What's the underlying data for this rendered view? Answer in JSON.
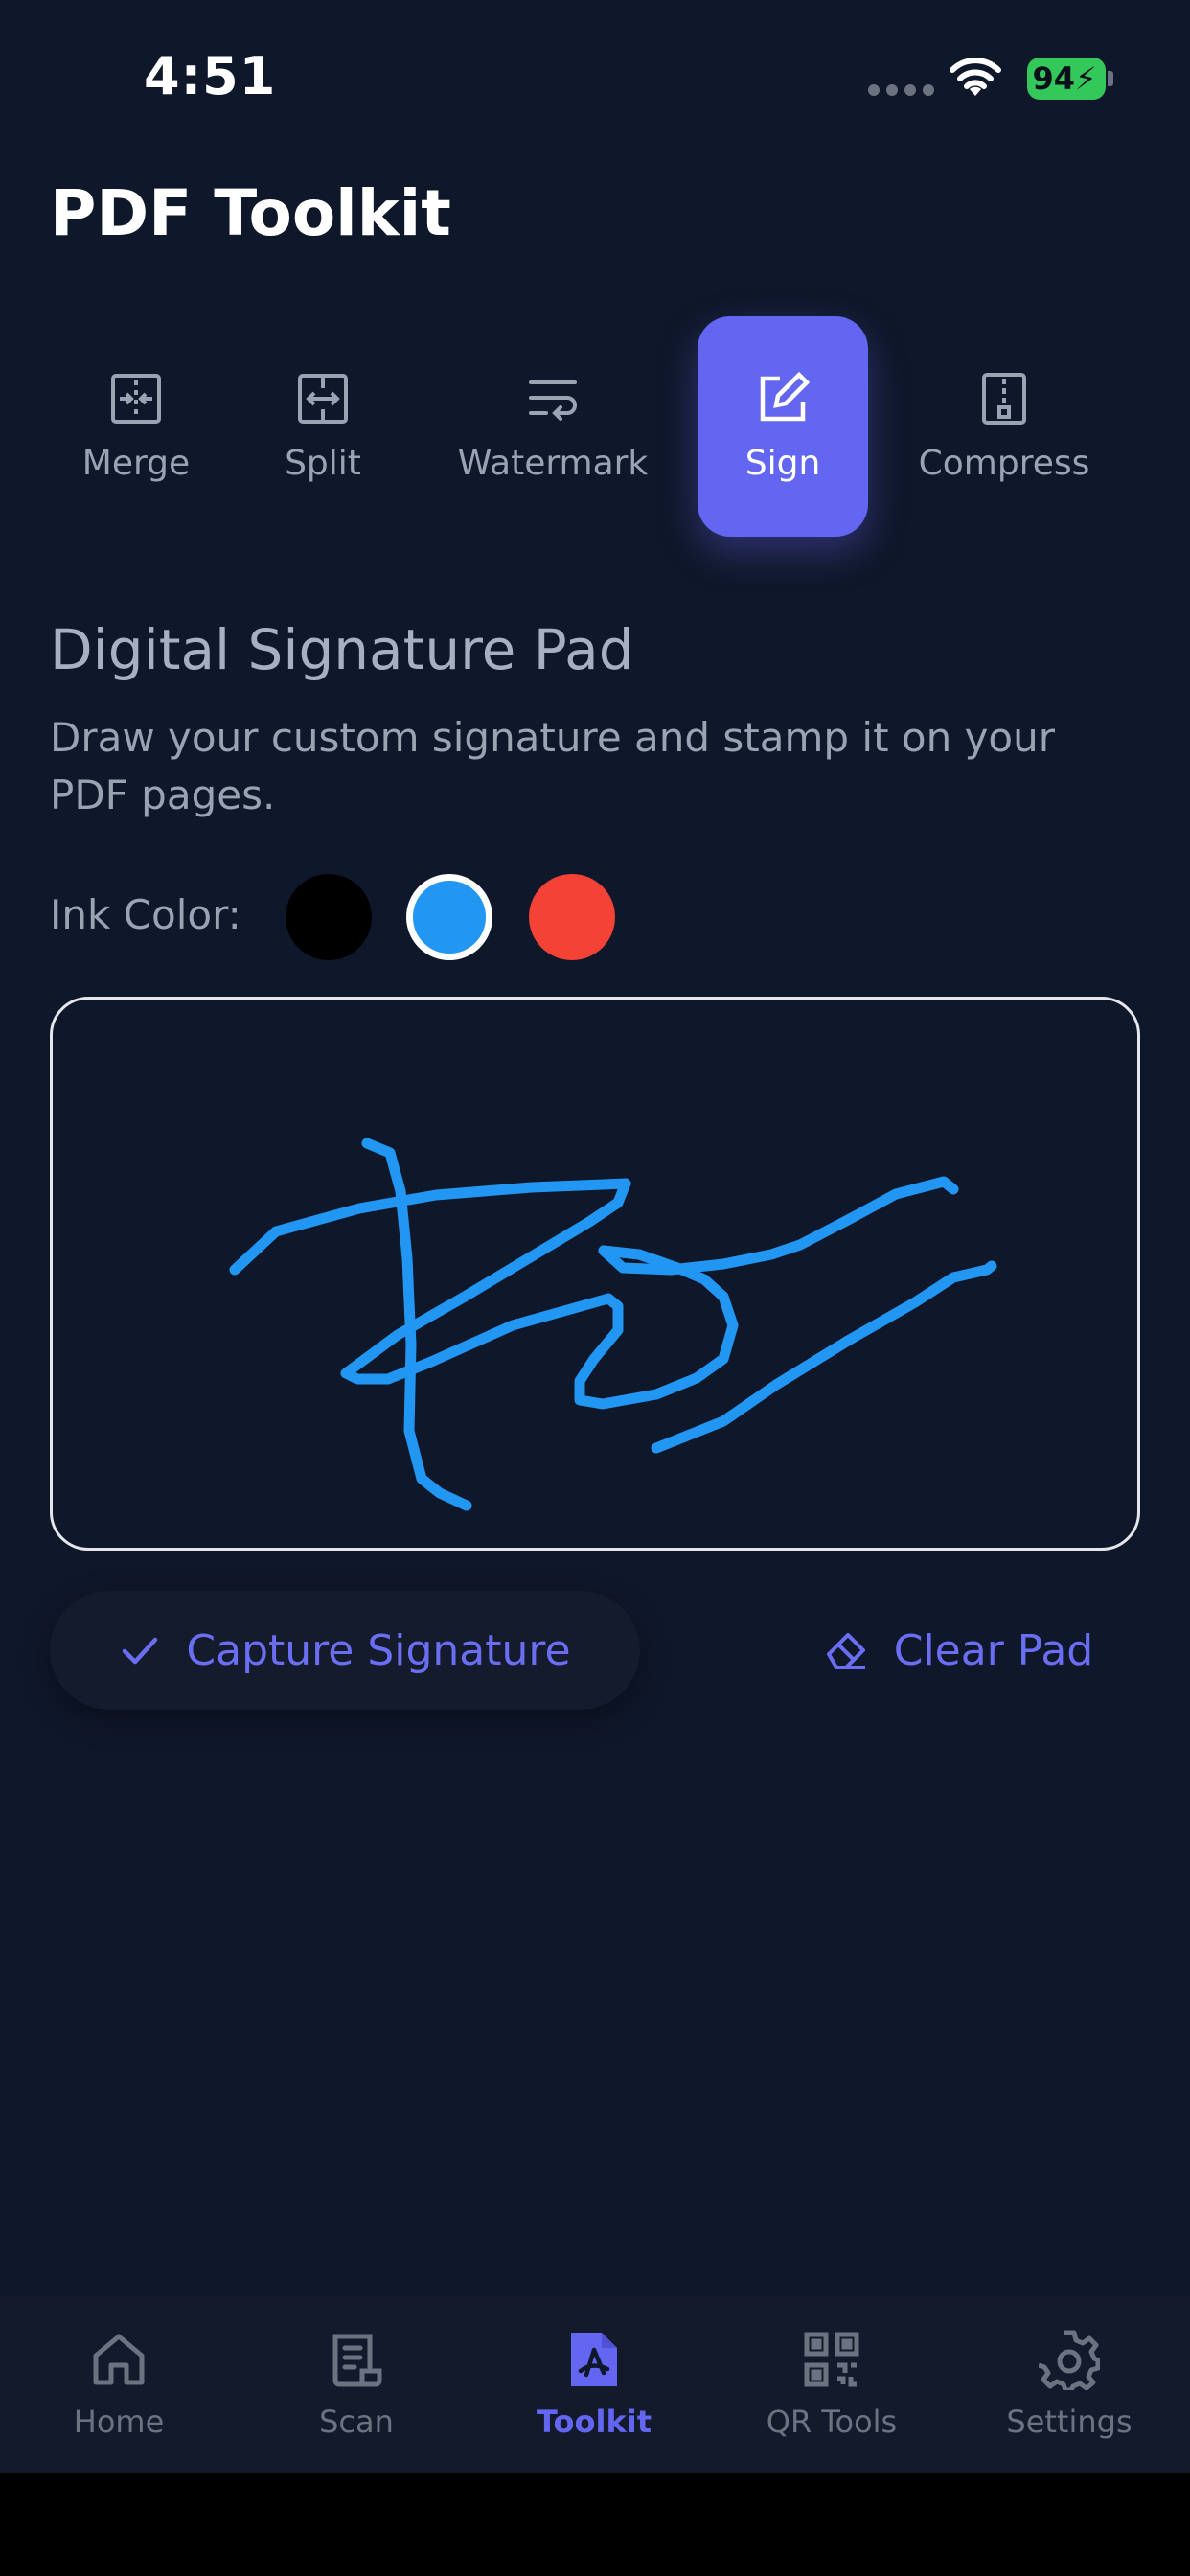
{
  "status": {
    "time": "4:51",
    "battery": "94"
  },
  "header": {
    "title": "PDF Toolkit"
  },
  "tools": [
    {
      "label": "Merge",
      "icon": "merge-icon"
    },
    {
      "label": "Split",
      "icon": "split-icon"
    },
    {
      "label": "Watermark",
      "icon": "watermark-icon"
    },
    {
      "label": "Sign",
      "icon": "sign-icon",
      "active": true
    },
    {
      "label": "Compress",
      "icon": "compress-icon"
    }
  ],
  "signature": {
    "title": "Digital Signature Pad",
    "description": "Draw your custom signature and stamp it on your PDF pages.",
    "ink_label": "Ink Color:",
    "colors": [
      "#000000",
      "#2196f3",
      "#f44336"
    ],
    "selected_color": "#2196f3",
    "capture_label": "Capture Signature",
    "clear_label": "Clear Pad"
  },
  "nav": [
    {
      "label": "Home",
      "icon": "home-icon"
    },
    {
      "label": "Scan",
      "icon": "scan-icon"
    },
    {
      "label": "Toolkit",
      "icon": "toolkit-icon",
      "active": true
    },
    {
      "label": "QR Tools",
      "icon": "qr-icon"
    },
    {
      "label": "Settings",
      "icon": "settings-icon"
    }
  ],
  "colors": {
    "background": "#0f172a",
    "accent": "#6366f1",
    "ink": "#2196f3"
  }
}
